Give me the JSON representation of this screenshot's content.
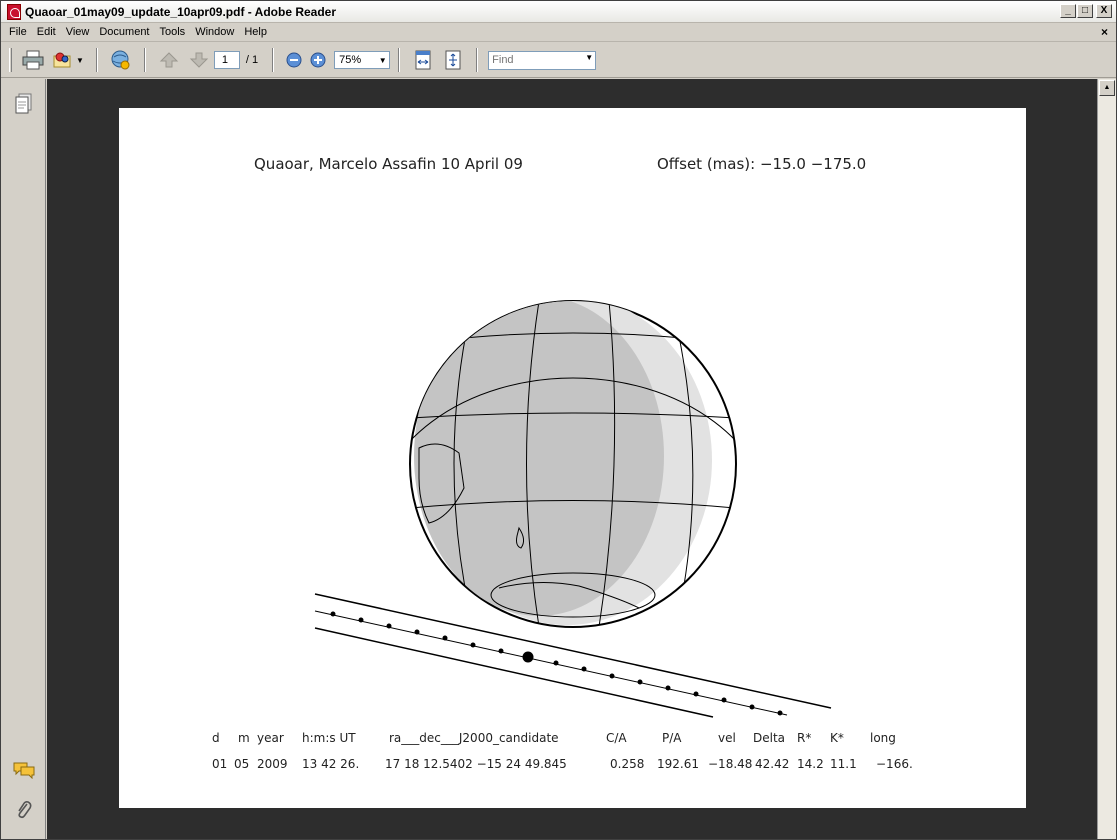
{
  "window": {
    "title": "Quaoar_01may09_update_10apr09.pdf - Adobe Reader"
  },
  "window_buttons": {
    "minimize": "_",
    "maximize": "□",
    "close": "X"
  },
  "menu": [
    {
      "label": "File"
    },
    {
      "label": "Edit"
    },
    {
      "label": "View"
    },
    {
      "label": "Document"
    },
    {
      "label": "Tools"
    },
    {
      "label": "Window"
    },
    {
      "label": "Help"
    }
  ],
  "doc_close": "×",
  "toolbar": {
    "page_current": "1",
    "page_total": "/ 1",
    "zoom": "75%",
    "find_placeholder": "Find"
  },
  "icons": {
    "print": "printer-icon",
    "email": "email-icon",
    "search": "search-web-icon",
    "prev": "up-arrow-icon",
    "next": "down-arrow-icon",
    "zoom_out": "zoom-out-icon",
    "zoom_in": "zoom-in-icon",
    "fit_width": "fit-width-icon",
    "fit_page": "fit-page-icon",
    "pages": "pages-icon",
    "comments": "comments-icon",
    "attachments": "paperclip-icon"
  },
  "document": {
    "title_left": "Quaoar, Marcelo Assafin 10 April 09",
    "title_right": "Offset (mas):  −15.0 −175.0",
    "header": {
      "d": "d",
      "m": "m",
      "year": "year",
      "hms": "h:m:s UT",
      "radec": "ra___dec___J2000_candidate",
      "ca": "C/A",
      "pa": "P/A",
      "vel": "vel",
      "delta": "Delta",
      "rstar": "R*",
      "kstar": "K*",
      "long": "long"
    },
    "values": {
      "d": "01",
      "m": "05",
      "year": "2009",
      "hms": "13 42 26.",
      "radec": "17 18 12.5402 −15 24  49.845",
      "ca": "0.258",
      "pa": "192.61",
      "vel": "−18.48",
      "delta": "42.42",
      "rstar": "14.2",
      "kstar": "11.1",
      "long": "−166."
    }
  }
}
